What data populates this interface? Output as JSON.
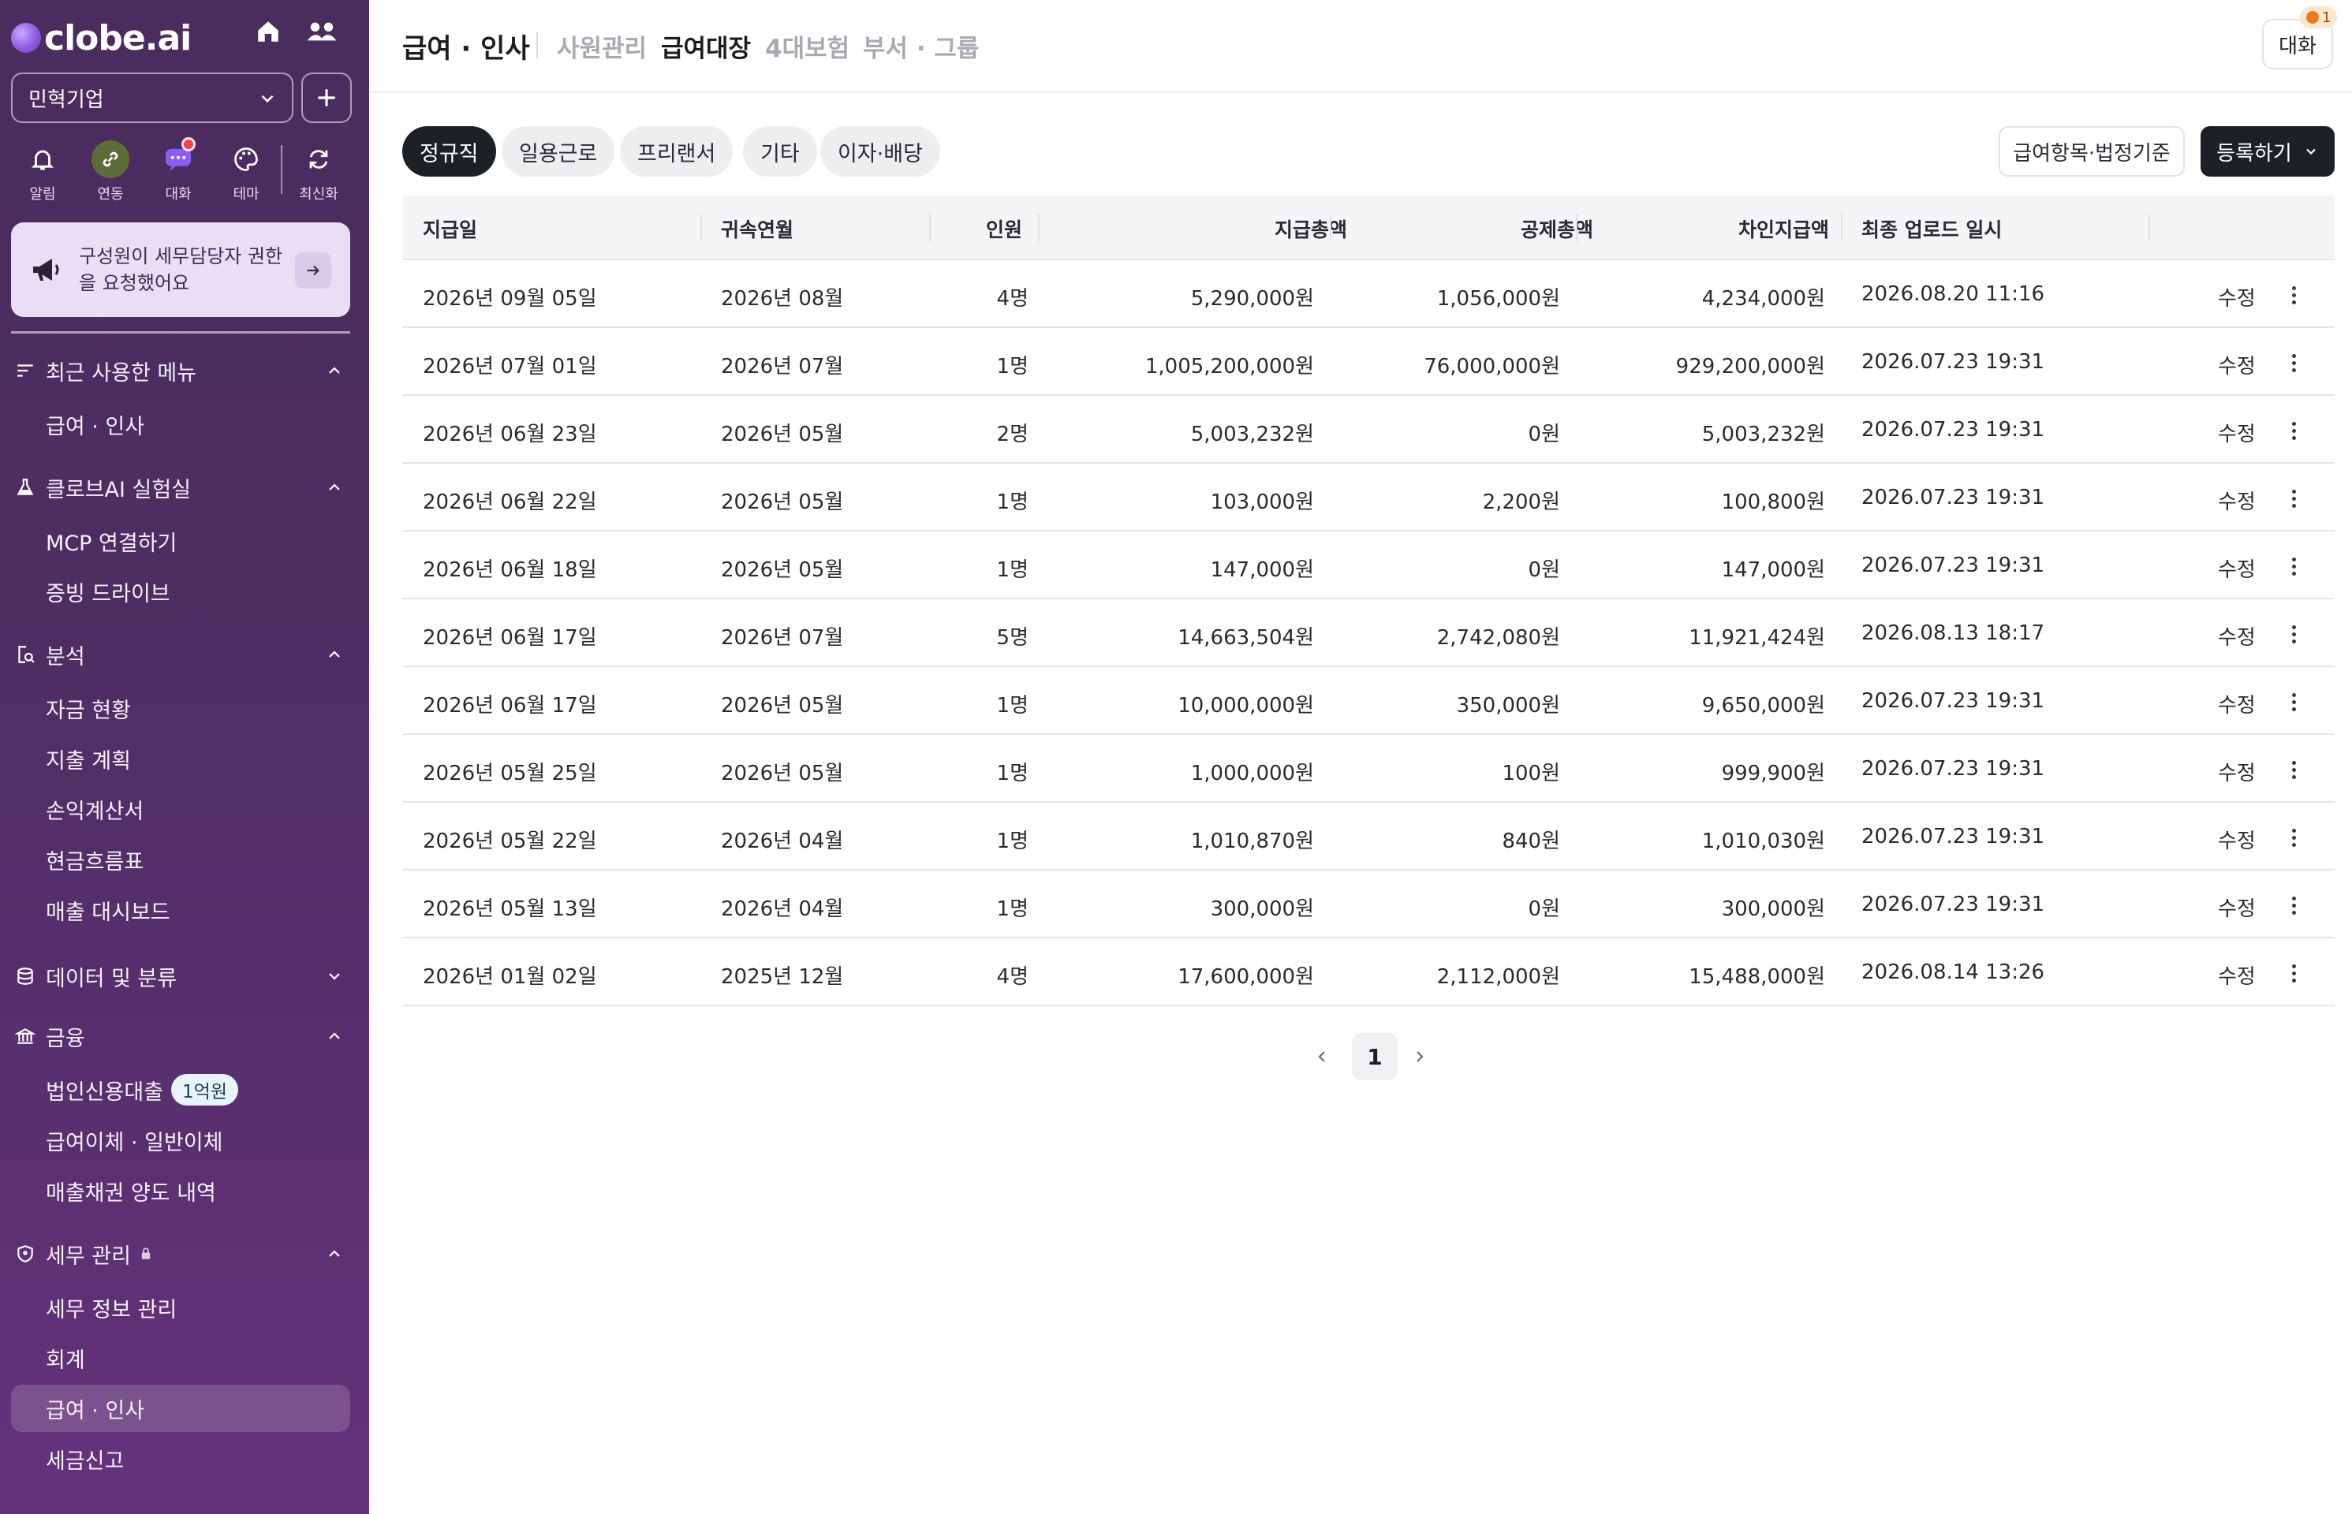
{
  "sidebar": {
    "logo": "clobe.ai",
    "company": "민혁기업",
    "quick": [
      {
        "label": "알림",
        "icon": "bell-icon"
      },
      {
        "label": "연동",
        "icon": "link-icon"
      },
      {
        "label": "대화",
        "icon": "chat-icon"
      },
      {
        "label": "테마",
        "icon": "palette-icon"
      },
      {
        "label": "최신화",
        "icon": "refresh-icon"
      }
    ],
    "notice": "구성원이 세무담당자 권한을 요청했어요",
    "sections": {
      "recent": {
        "label": "최근 사용한 메뉴",
        "items": [
          "급여 · 인사"
        ]
      },
      "lab": {
        "label": "클로브AI 실험실",
        "items": [
          "MCP 연결하기",
          "증빙 드라이브"
        ]
      },
      "analysis": {
        "label": "분석",
        "items": [
          "자금 현황",
          "지출 계획",
          "손익계산서",
          "현금흐름표",
          "매출 대시보드"
        ]
      },
      "data": {
        "label": "데이터 및 분류"
      },
      "finance": {
        "label": "금융",
        "items": [
          "법인신용대출",
          "급여이체 · 일반이체",
          "매출채권 양도 내역"
        ],
        "loan_badge": "1억원"
      },
      "tax": {
        "label": "세무 관리",
        "items": [
          "세무 정보 관리",
          "회계",
          "급여 · 인사",
          "세금신고"
        ]
      }
    }
  },
  "header": {
    "title": "급여 · 인사",
    "tabs": [
      "사원관리",
      "급여대장",
      "4대보험",
      "부서 · 그룹"
    ],
    "active_tab": "급여대장",
    "chat_label": "대화",
    "chat_badge": "1"
  },
  "filters": {
    "chips": [
      "정규직",
      "일용근로",
      "프리랜서",
      "기타",
      "이자·배당"
    ],
    "active": "정규직",
    "settings_button": "급여항목·법정기준",
    "register_button": "등록하기"
  },
  "table": {
    "columns": [
      "지급일",
      "귀속연월",
      "인원",
      "지급총액",
      "공제총액",
      "차인지급액",
      "최종 업로드 일시"
    ],
    "edit_label": "수정",
    "rows": [
      [
        "2026년 09월 05일",
        "2026년 08월",
        "4명",
        "5,290,000원",
        "1,056,000원",
        "4,234,000원",
        "2026.08.20 11:16"
      ],
      [
        "2026년 07월 01일",
        "2026년 07월",
        "1명",
        "1,005,200,000원",
        "76,000,000원",
        "929,200,000원",
        "2026.07.23 19:31"
      ],
      [
        "2026년 06월 23일",
        "2026년 05월",
        "2명",
        "5,003,232원",
        "0원",
        "5,003,232원",
        "2026.07.23 19:31"
      ],
      [
        "2026년 06월 22일",
        "2026년 05월",
        "1명",
        "103,000원",
        "2,200원",
        "100,800원",
        "2026.07.23 19:31"
      ],
      [
        "2026년 06월 18일",
        "2026년 05월",
        "1명",
        "147,000원",
        "0원",
        "147,000원",
        "2026.07.23 19:31"
      ],
      [
        "2026년 06월 17일",
        "2026년 07월",
        "5명",
        "14,663,504원",
        "2,742,080원",
        "11,921,424원",
        "2026.08.13 18:17"
      ],
      [
        "2026년 06월 17일",
        "2026년 05월",
        "1명",
        "10,000,000원",
        "350,000원",
        "9,650,000원",
        "2026.07.23 19:31"
      ],
      [
        "2026년 05월 25일",
        "2026년 05월",
        "1명",
        "1,000,000원",
        "100원",
        "999,900원",
        "2026.07.23 19:31"
      ],
      [
        "2026년 05월 22일",
        "2026년 04월",
        "1명",
        "1,010,870원",
        "840원",
        "1,010,030원",
        "2026.07.23 19:31"
      ],
      [
        "2026년 05월 13일",
        "2026년 04월",
        "1명",
        "300,000원",
        "0원",
        "300,000원",
        "2026.07.23 19:31"
      ],
      [
        "2026년 01월 02일",
        "2025년 12월",
        "4명",
        "17,600,000원",
        "2,112,000원",
        "15,488,000원",
        "2026.08.14 13:26"
      ]
    ]
  },
  "pagination": {
    "current": "1"
  }
}
